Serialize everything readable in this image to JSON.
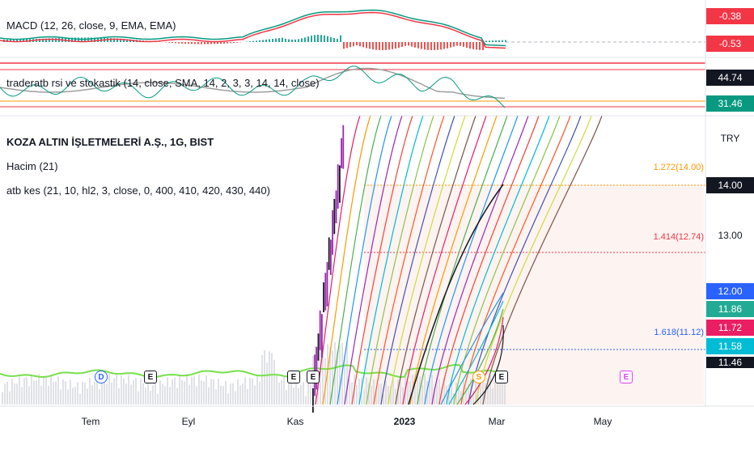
{
  "panes": {
    "macd": {
      "label": "MACD (12, 26, close, 9, EMA, EMA)",
      "price_tags": [
        {
          "text": "-0.38",
          "color": "#f23645"
        },
        {
          "text": "-0.53",
          "color": "#f23645"
        }
      ]
    },
    "rsi": {
      "label": "traderatb rsi ve stokastik (14, close, SMA, 14, 2, 3, 3, 14, 14, close)",
      "price_tags": [
        {
          "text": "44.74",
          "color": "#131722"
        },
        {
          "text": "31.46",
          "color": "#089981"
        }
      ]
    },
    "main": {
      "title": "KOZA ALTIN İŞLETMELERİ A.Ş., 1G, BIST",
      "volume_label": "Hacim (21)",
      "indicator_label": "atb kes (21, 10, hl2, 3, close, 0, 400, 410, 420, 430, 440)",
      "currency": "TRY",
      "axis_ticks": [
        "13.00"
      ],
      "price_tags": [
        {
          "text": "14.00",
          "color": "#131722"
        },
        {
          "text": "12.00",
          "color": "#2962ff"
        },
        {
          "text": "11.86",
          "color": "#22ab94"
        },
        {
          "text": "11.72",
          "color": "#e91e63"
        },
        {
          "text": "11.58",
          "color": "#00bcd4"
        },
        {
          "text": "11.46",
          "color": "#131722"
        }
      ],
      "fib_levels": [
        {
          "text": "1.272(14.00)",
          "color": "#ff9800"
        },
        {
          "text": "1.414(12.74)",
          "color": "#f23645"
        },
        {
          "text": "1.618(11.12)",
          "color": "#2962ff"
        }
      ]
    }
  },
  "time_axis": [
    "Tem",
    "Eyl",
    "Kas",
    "2023",
    "Mar",
    "May"
  ],
  "event_markers": [
    {
      "text": "D",
      "color": "#2962ff",
      "shape": "circle"
    },
    {
      "text": "E",
      "color": "#131722",
      "shape": "square"
    },
    {
      "text": "E",
      "color": "#131722",
      "shape": "square"
    },
    {
      "text": "E",
      "color": "#131722",
      "shape": "square"
    },
    {
      "text": "S",
      "color": "#ff9800",
      "shape": "circle"
    },
    {
      "text": "E",
      "color": "#131722",
      "shape": "square"
    },
    {
      "text": "E",
      "color": "#e040fb",
      "shape": "square"
    }
  ],
  "chart_data": {
    "type": "line",
    "title": "KOZA ALTIN İŞLETMELERİ A.Ş., 1G, BIST",
    "ylim": [
      11.46,
      14.6
    ],
    "y_ticks": [
      13.0
    ],
    "x_ticks": [
      "Tem",
      "Eyl",
      "Kas",
      "2023",
      "Mar",
      "May"
    ],
    "fib_levels": [
      {
        "ratio": 1.272,
        "price": 14.0
      },
      {
        "ratio": 1.414,
        "price": 12.74
      },
      {
        "ratio": 1.618,
        "price": 11.12
      }
    ],
    "series": [
      {
        "name": "MACD",
        "values": [
          -0.38
        ]
      },
      {
        "name": "Signal",
        "values": [
          -0.53
        ]
      },
      {
        "name": "RSI",
        "values": [
          31.46
        ]
      },
      {
        "name": "RSI MA",
        "values": [
          44.74
        ]
      }
    ],
    "colors": {
      "macd_line": "#089981",
      "signal_line": "#f23645",
      "volume_ma": "#76e04a",
      "candle_up": "#9c27b0"
    }
  }
}
